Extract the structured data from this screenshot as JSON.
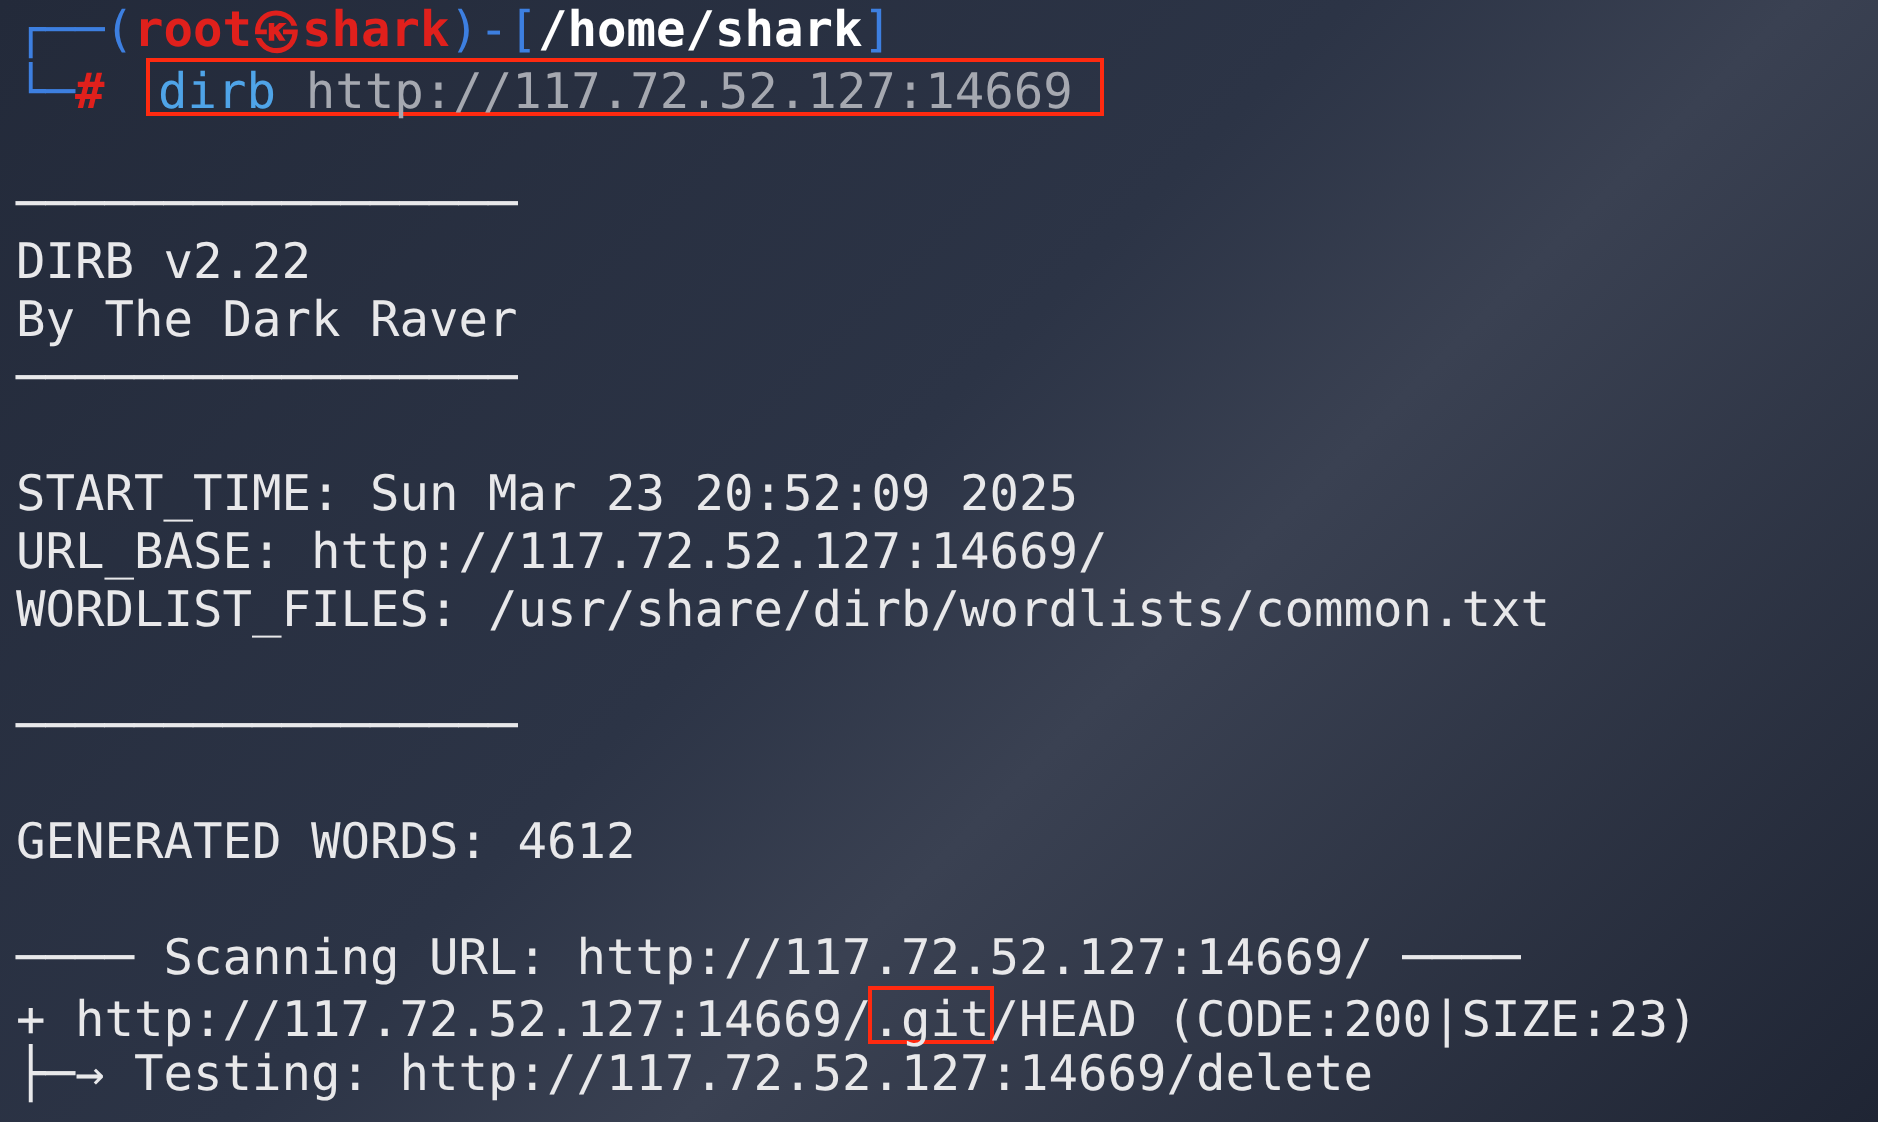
{
  "prompt": {
    "top": [
      {
        "kind": "frame",
        "text": "┌──("
      },
      {
        "kind": "user",
        "text": "root㉿shark"
      },
      {
        "kind": "frame",
        "text": ")-["
      },
      {
        "kind": "path",
        "text": "/home/shark"
      },
      {
        "kind": "frame",
        "text": "]"
      }
    ],
    "corner": "└─",
    "symbol": "#"
  },
  "command": {
    "program": "dirb",
    "argument": "http://117.72.52.127:14669",
    "highlighted": true
  },
  "output": [
    {
      "kind": "blank"
    },
    {
      "kind": "rule",
      "text": "─────────────────"
    },
    {
      "kind": "text",
      "text": "DIRB v2.22"
    },
    {
      "kind": "text",
      "text": "By The Dark Raver"
    },
    {
      "kind": "rule",
      "text": "─────────────────"
    },
    {
      "kind": "blank"
    },
    {
      "kind": "text",
      "text": "START_TIME: Sun Mar 23 20:52:09 2025"
    },
    {
      "kind": "text",
      "text": "URL_BASE: http://117.72.52.127:14669/"
    },
    {
      "kind": "text",
      "text": "WORDLIST_FILES: /usr/share/dirb/wordlists/common.txt"
    },
    {
      "kind": "blank"
    },
    {
      "kind": "rule",
      "text": "─────────────────"
    },
    {
      "kind": "blank"
    },
    {
      "kind": "text",
      "text": "GENERATED WORDS: 4612"
    },
    {
      "kind": "blank"
    },
    {
      "kind": "text",
      "text": "──── Scanning URL: http://117.72.52.127:14669/ ────"
    },
    {
      "kind": "result",
      "segments": [
        {
          "text": "+ http://117.72.52.127:14669/",
          "highlighted": false
        },
        {
          "text": ".git",
          "highlighted": true
        },
        {
          "text": "/HEAD (CODE:200|SIZE:23)",
          "highlighted": false
        }
      ]
    },
    {
      "kind": "text",
      "text": "├─→ Testing: http://117.72.52.127:14669/delete"
    }
  ]
}
